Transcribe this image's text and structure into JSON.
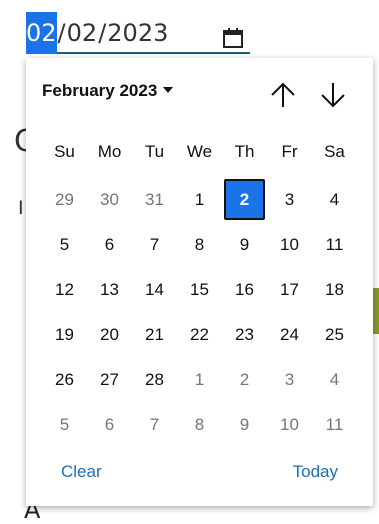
{
  "background": {
    "big_letter": "C",
    "small_letter": "I",
    "bottom_letter": "A"
  },
  "date_input": {
    "month": "02",
    "day": "02",
    "year": "2023",
    "separator": "/",
    "selected_segment": "month",
    "calendar_icon": "calendar-icon"
  },
  "picker": {
    "month_label": "February 2023",
    "prev_icon": "arrow-up-icon",
    "next_icon": "arrow-down-icon",
    "weekdays": [
      "Su",
      "Mo",
      "Tu",
      "We",
      "Th",
      "Fr",
      "Sa"
    ],
    "weeks": [
      [
        {
          "d": "29",
          "o": true
        },
        {
          "d": "30",
          "o": true
        },
        {
          "d": "31",
          "o": true
        },
        {
          "d": "1"
        },
        {
          "d": "2",
          "sel": true
        },
        {
          "d": "3"
        },
        {
          "d": "4"
        }
      ],
      [
        {
          "d": "5"
        },
        {
          "d": "6"
        },
        {
          "d": "7"
        },
        {
          "d": "8"
        },
        {
          "d": "9"
        },
        {
          "d": "10"
        },
        {
          "d": "11"
        }
      ],
      [
        {
          "d": "12"
        },
        {
          "d": "13"
        },
        {
          "d": "14"
        },
        {
          "d": "15"
        },
        {
          "d": "16"
        },
        {
          "d": "17"
        },
        {
          "d": "18"
        }
      ],
      [
        {
          "d": "19"
        },
        {
          "d": "20"
        },
        {
          "d": "21"
        },
        {
          "d": "22"
        },
        {
          "d": "23"
        },
        {
          "d": "24"
        },
        {
          "d": "25"
        }
      ],
      [
        {
          "d": "26"
        },
        {
          "d": "27"
        },
        {
          "d": "28"
        },
        {
          "d": "1",
          "o": true
        },
        {
          "d": "2",
          "o": true
        },
        {
          "d": "3",
          "o": true
        },
        {
          "d": "4",
          "o": true
        }
      ],
      [
        {
          "d": "5",
          "o": true
        },
        {
          "d": "6",
          "o": true
        },
        {
          "d": "7",
          "o": true
        },
        {
          "d": "8",
          "o": true
        },
        {
          "d": "9",
          "o": true
        },
        {
          "d": "10",
          "o": true
        },
        {
          "d": "11",
          "o": true
        }
      ]
    ],
    "clear_label": "Clear",
    "today_label": "Today"
  },
  "colors": {
    "accent": "#1a73e8",
    "link": "#1a6fb5",
    "underline": "#1d5f73",
    "other_month_text": "#767676"
  }
}
